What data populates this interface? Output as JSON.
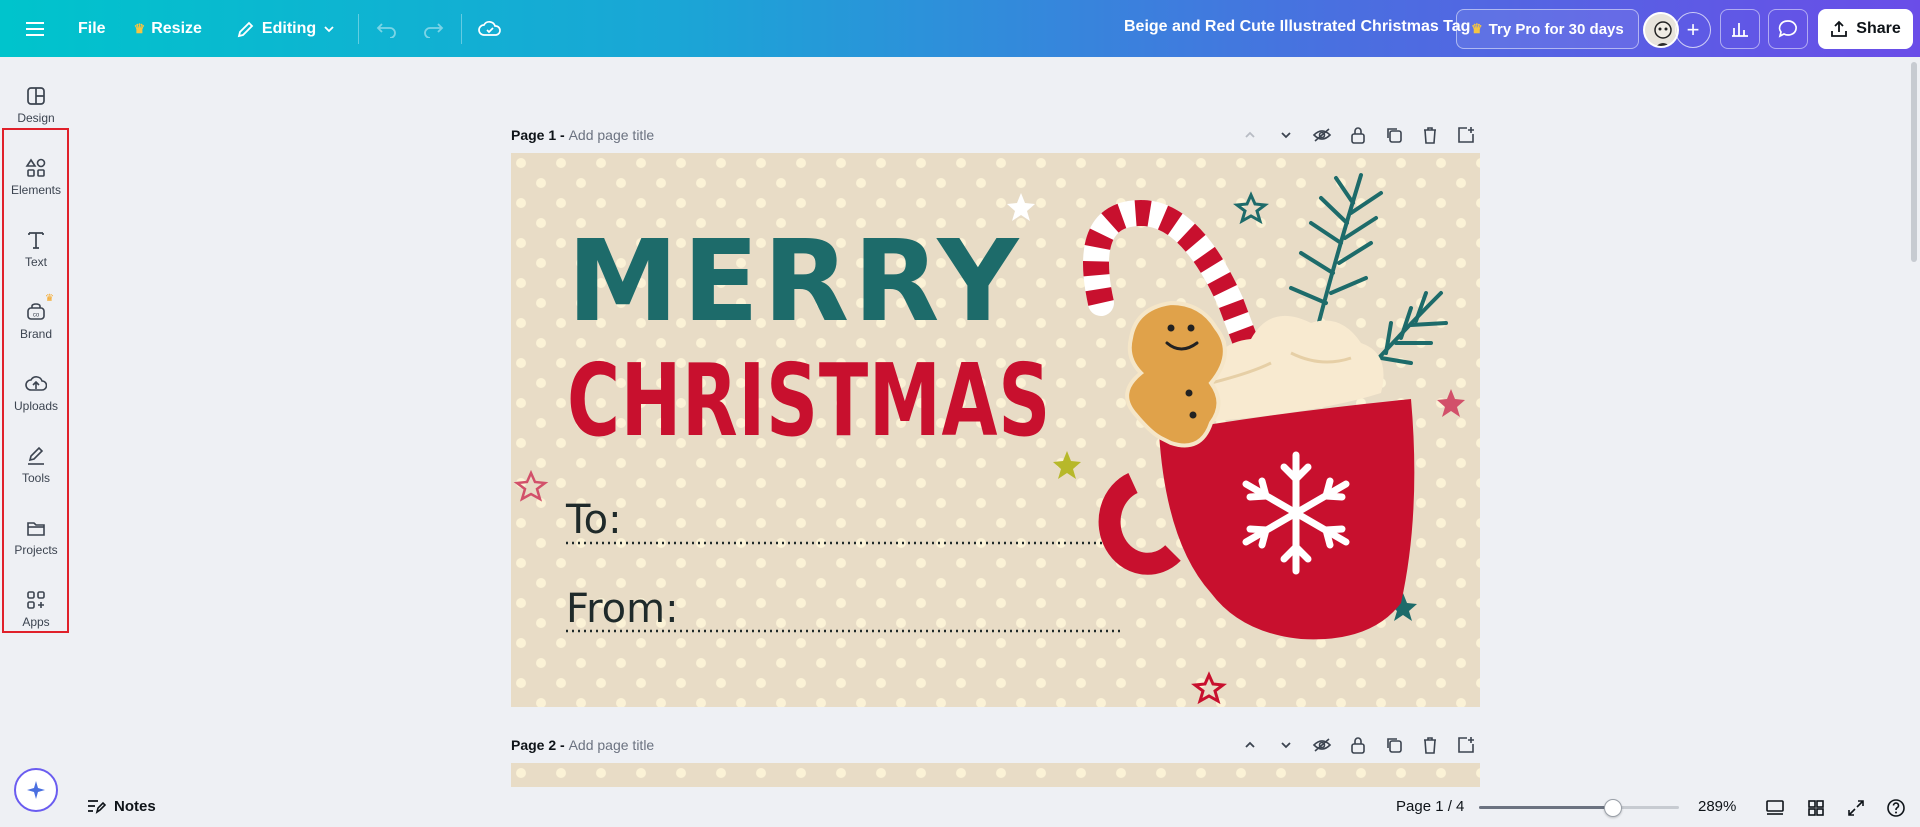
{
  "topbar": {
    "menu_icon": "hamburger-icon",
    "file_label": "File",
    "resize_label": "Resize",
    "editing_label": "Editing",
    "doc_title": "Beige and Red Cute Illustrated Christmas Tag",
    "pro_label": "Try Pro for 30 days",
    "share_label": "Share",
    "gradient_start": "#00c4cc",
    "gradient_end": "#6a4de8"
  },
  "sidebar": {
    "items": [
      {
        "label": "Design",
        "icon": "layout-icon"
      },
      {
        "label": "Elements",
        "icon": "shapes-icon"
      },
      {
        "label": "Text",
        "icon": "text-icon"
      },
      {
        "label": "Brand",
        "icon": "brand-icon"
      },
      {
        "label": "Uploads",
        "icon": "cloud-upload-icon"
      },
      {
        "label": "Tools",
        "icon": "pen-icon"
      },
      {
        "label": "Projects",
        "icon": "folder-icon"
      },
      {
        "label": "Apps",
        "icon": "apps-icon"
      }
    ]
  },
  "canvas": {
    "page1": {
      "label": "Page 1 -",
      "sub": "Add page title"
    },
    "page2": {
      "label": "Page 2 -",
      "sub": "Add page title"
    },
    "design": {
      "line1": "MERRY",
      "line2": "CHRISTMAS",
      "to_label": "To:",
      "from_label": "From:",
      "bg_color": "#e8dcc6",
      "teal": "#1d6b6a",
      "red": "#c8102e"
    }
  },
  "bottom": {
    "notes_label": "Notes",
    "page_count": "Page 1 / 4",
    "zoom": "289%",
    "zoom_fraction": 0.67
  }
}
